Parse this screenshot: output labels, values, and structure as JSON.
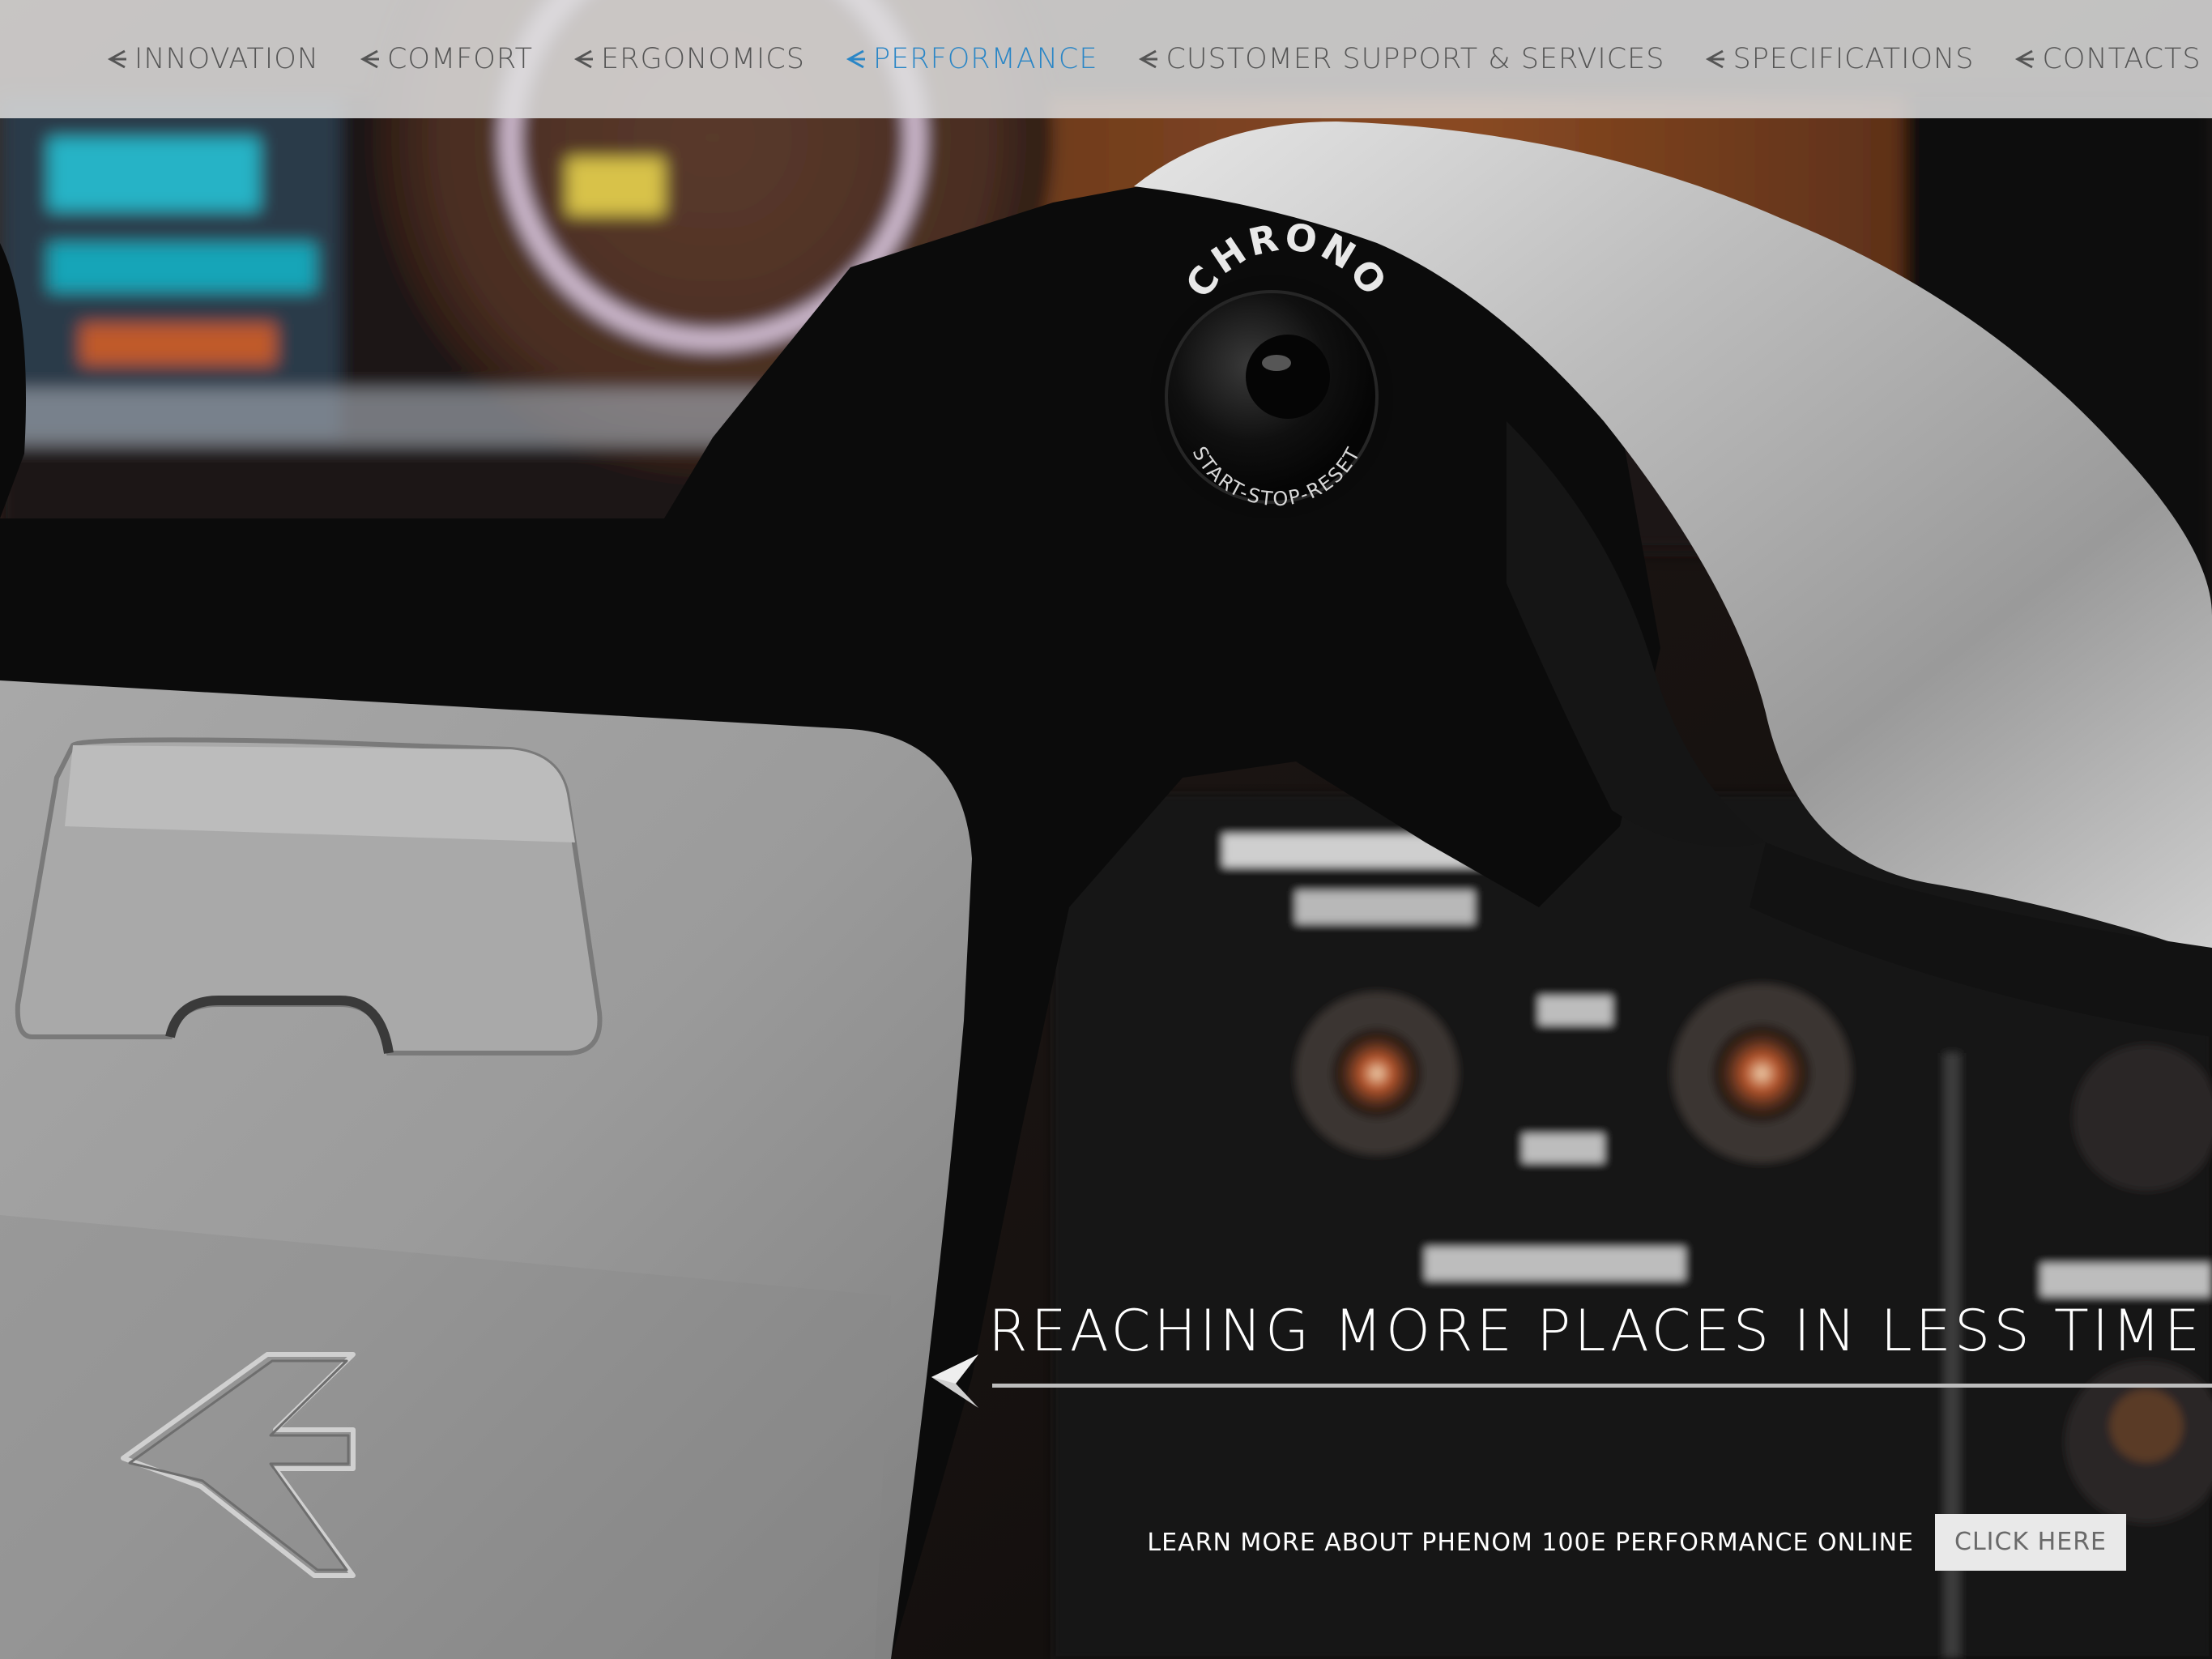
{
  "nav": {
    "items": [
      {
        "label": "INNOVATION",
        "active": false
      },
      {
        "label": "COMFORT",
        "active": false
      },
      {
        "label": "ERGONOMICS",
        "active": false
      },
      {
        "label": "PERFORMANCE",
        "active": true
      },
      {
        "label": "CUSTOMER SUPPORT & SERVICES",
        "active": false
      },
      {
        "label": "SPECIFICATIONS",
        "active": false
      },
      {
        "label": "CONTACTS",
        "active": false
      }
    ]
  },
  "hero": {
    "headline": "REACHING MORE PLACES IN LESS TIME",
    "yoke_button_top": "CHRONO",
    "yoke_button_bottom": "START-STOP-RESET"
  },
  "cta": {
    "text": "LEARN MORE ABOUT PHENOM 100E PERFORMANCE ONLINE",
    "button_label": "CLICK HERE"
  },
  "colors": {
    "accent": "#2a86c6",
    "nav_text": "#555555",
    "nav_bg": "#dedede",
    "cta_button_bg": "#e9e9e9",
    "cta_button_text": "#6a6a6a"
  },
  "icons": {
    "nav_chevron": "chevron-left-icon",
    "headline_arrow": "chevron-arrow-icon",
    "logo_plane": "airplane-logo-icon"
  }
}
